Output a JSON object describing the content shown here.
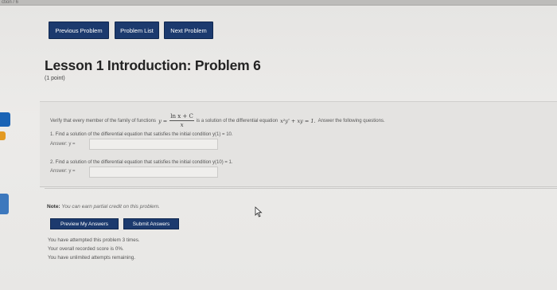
{
  "breadcrumb": "ction / 6",
  "nav": {
    "previous": "Previous Problem",
    "list": "Problem List",
    "next": "Next Problem"
  },
  "title": "Lesson 1 Introduction: Problem 6",
  "points": "(1 point)",
  "problem": {
    "statement_lead": "Verify that every member of the family of functions",
    "y_eq": "y =",
    "frac_num": "ln x + C",
    "frac_den": "x",
    "statement_mid": "is a solution of the differential equation",
    "equation": "x²y' + xy = 1.",
    "statement_tail": "Answer the following questions.",
    "part1": "1. Find a solution of the differential equation that satisfies the initial condition y(1) = 10.",
    "part2": "2. Find a solution of the differential equation that satisfies the initial condition y(10) = 1.",
    "answer_label": "Answer: y ="
  },
  "note_label": "Note:",
  "note_text": "You can earn partial credit on this problem.",
  "buttons": {
    "preview": "Preview My Answers",
    "submit": "Submit Answers"
  },
  "status": {
    "attempted": "You have attempted this problem 3 times.",
    "score": "Your overall recorded score is 0%.",
    "remaining": "You have unlimited attempts remaining."
  }
}
